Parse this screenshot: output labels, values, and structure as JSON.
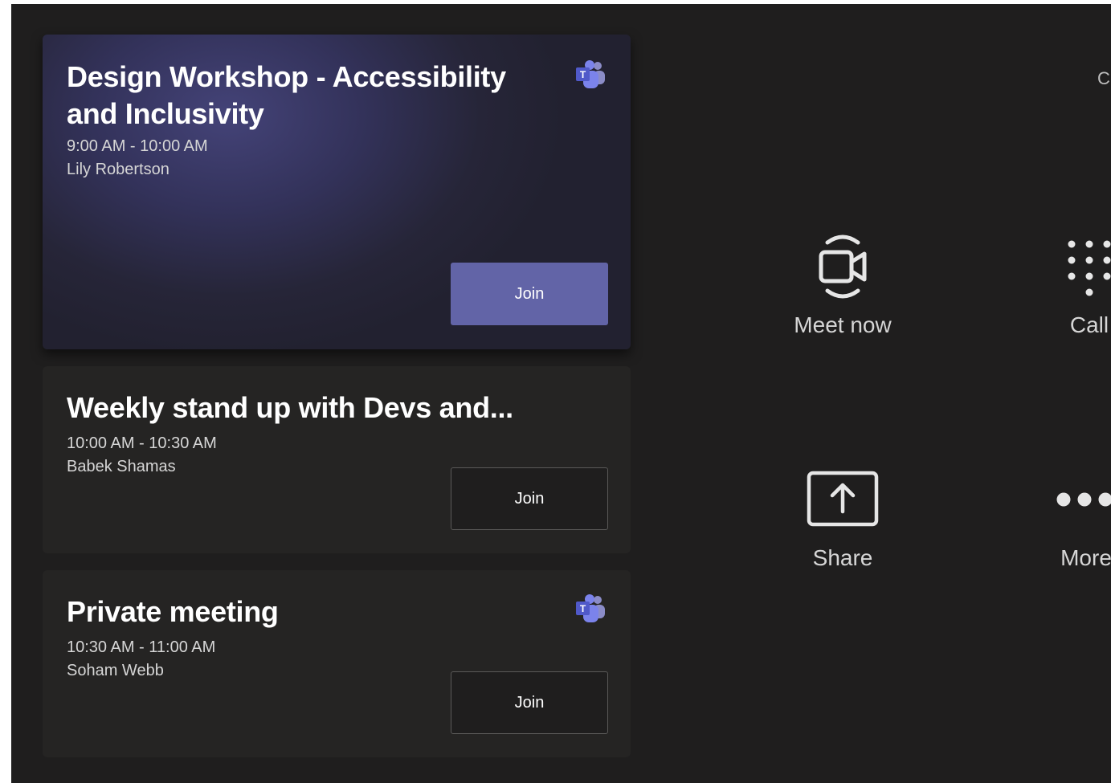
{
  "meetings": [
    {
      "title": "Design Workshop - Accessibility and Inclusivity",
      "time": "9:00 AM - 10:00 AM",
      "organizer": "Lily Robertson",
      "join_label": "Join",
      "teams_icon": "teams-icon"
    },
    {
      "title": "Weekly stand up with Devs and...",
      "time": "10:00 AM - 10:30 AM",
      "organizer": "Babek Shamas",
      "join_label": "Join"
    },
    {
      "title": "Private meeting",
      "time": "10:30 AM - 11:00 AM",
      "organizer": "Soham Webb",
      "join_label": "Join",
      "teams_icon": "teams-icon"
    }
  ],
  "actions": {
    "meet_now": {
      "label": "Meet now",
      "icon": "video-camera-icon"
    },
    "call": {
      "label": "Call",
      "icon": "dialpad-icon"
    },
    "share": {
      "label": "Share",
      "icon": "share-screen-icon"
    },
    "more": {
      "label": "More",
      "icon": "more-dots-icon"
    }
  },
  "corner_text": "C",
  "colors": {
    "background": "#1f1e1e",
    "card": "#252423",
    "accent": "#6264a7"
  }
}
